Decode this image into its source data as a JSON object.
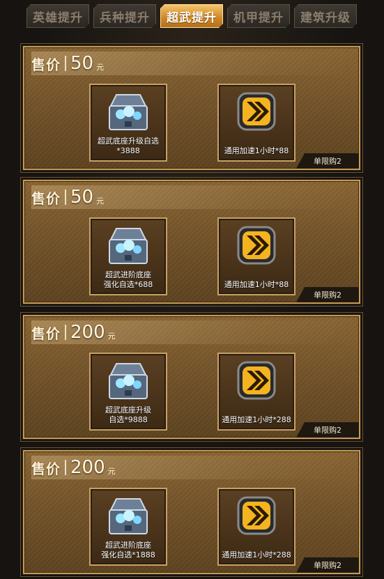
{
  "tabs": [
    {
      "label": "英雄提升",
      "active": false
    },
    {
      "label": "兵种提升",
      "active": false
    },
    {
      "label": "超武提升",
      "active": true
    },
    {
      "label": "机甲提升",
      "active": false
    },
    {
      "label": "建筑升级",
      "active": false
    }
  ],
  "cards": [
    {
      "price_label": "售价",
      "price": "50",
      "unit": "元",
      "item1": {
        "name": "超武底座升级自选\n*3888",
        "icon": "chest-icon"
      },
      "item2": {
        "name": "通用加速1小时*88",
        "icon": "speedup-icon"
      },
      "limit": "单限购2"
    },
    {
      "price_label": "售价",
      "price": "50",
      "unit": "元",
      "item1": {
        "name": "超武进阶底座\n强化自选*688",
        "icon": "chest-icon"
      },
      "item2": {
        "name": "通用加速1小时*88",
        "icon": "speedup-icon"
      },
      "limit": "单限购2"
    },
    {
      "price_label": "售价",
      "price": "200",
      "unit": "元",
      "item1": {
        "name": "超武底座升级\n自选*9888",
        "icon": "chest-icon"
      },
      "item2": {
        "name": "通用加速1小时*288",
        "icon": "speedup-icon"
      },
      "limit": "单限购2"
    },
    {
      "price_label": "售价",
      "price": "200",
      "unit": "元",
      "item1": {
        "name": "超武进阶底座\n强化自选*1888",
        "icon": "chest-icon"
      },
      "item2": {
        "name": "通用加速1小时*288",
        "icon": "speedup-icon"
      },
      "limit": "单限购2"
    }
  ]
}
